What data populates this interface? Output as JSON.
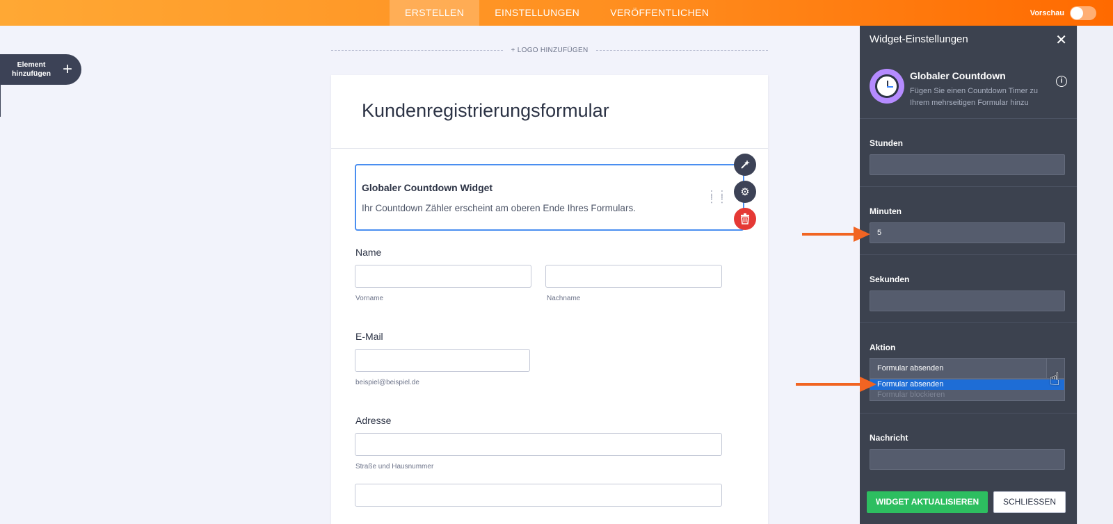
{
  "topbar": {
    "tabs": [
      {
        "label": "ERSTELLEN",
        "active": true
      },
      {
        "label": "EINSTELLUNGEN",
        "active": false
      },
      {
        "label": "VERÖFFENTLICHEN",
        "active": false
      }
    ],
    "preview_label": "Vorschau",
    "preview_enabled": false
  },
  "sidebar": {
    "add_element_label_line1": "Element",
    "add_element_label_line2": "hinzufügen",
    "add_icon": "plus-icon"
  },
  "form": {
    "logo_label": "+ LOGO HINZUFÜGEN",
    "title": "Kundenregistrierungsformular",
    "widget": {
      "title": "Globaler Countdown Widget",
      "description": "Ihr Countdown Zähler erscheint am oberen Ende Ihres Formulars."
    },
    "fields": {
      "name_label": "Name",
      "first_sub": "Vorname",
      "last_sub": "Nachname",
      "email_label": "E-Mail",
      "email_sub": "beispiel@beispiel.de",
      "address_label": "Adresse",
      "street_sub": "Straße und Hausnummer"
    }
  },
  "panel": {
    "title": "Widget-Einstellungen",
    "widget_name": "Globaler Countdown",
    "widget_desc": "Fügen Sie einen Countdown Timer zu Ihrem mehrseitigen Formular hinzu",
    "hours_label": "Stunden",
    "hours_value": "",
    "minutes_label": "Minuten",
    "minutes_value": "5",
    "seconds_label": "Sekunden",
    "seconds_value": "",
    "action_label": "Aktion",
    "action_value": "Formular absenden",
    "action_options": [
      "Formular absenden",
      "Formular blockieren"
    ],
    "message_label": "Nachricht",
    "message_value": "",
    "update_button": "WIDGET AKTUALISIEREN",
    "close_button": "SCHLIESSEN"
  },
  "colors": {
    "accent": "#ff8f20",
    "panel_bg": "#3c424f",
    "update_green": "#2dbe60",
    "annotation_orange": "#f16422",
    "selection_blue": "#1e6dd6"
  }
}
